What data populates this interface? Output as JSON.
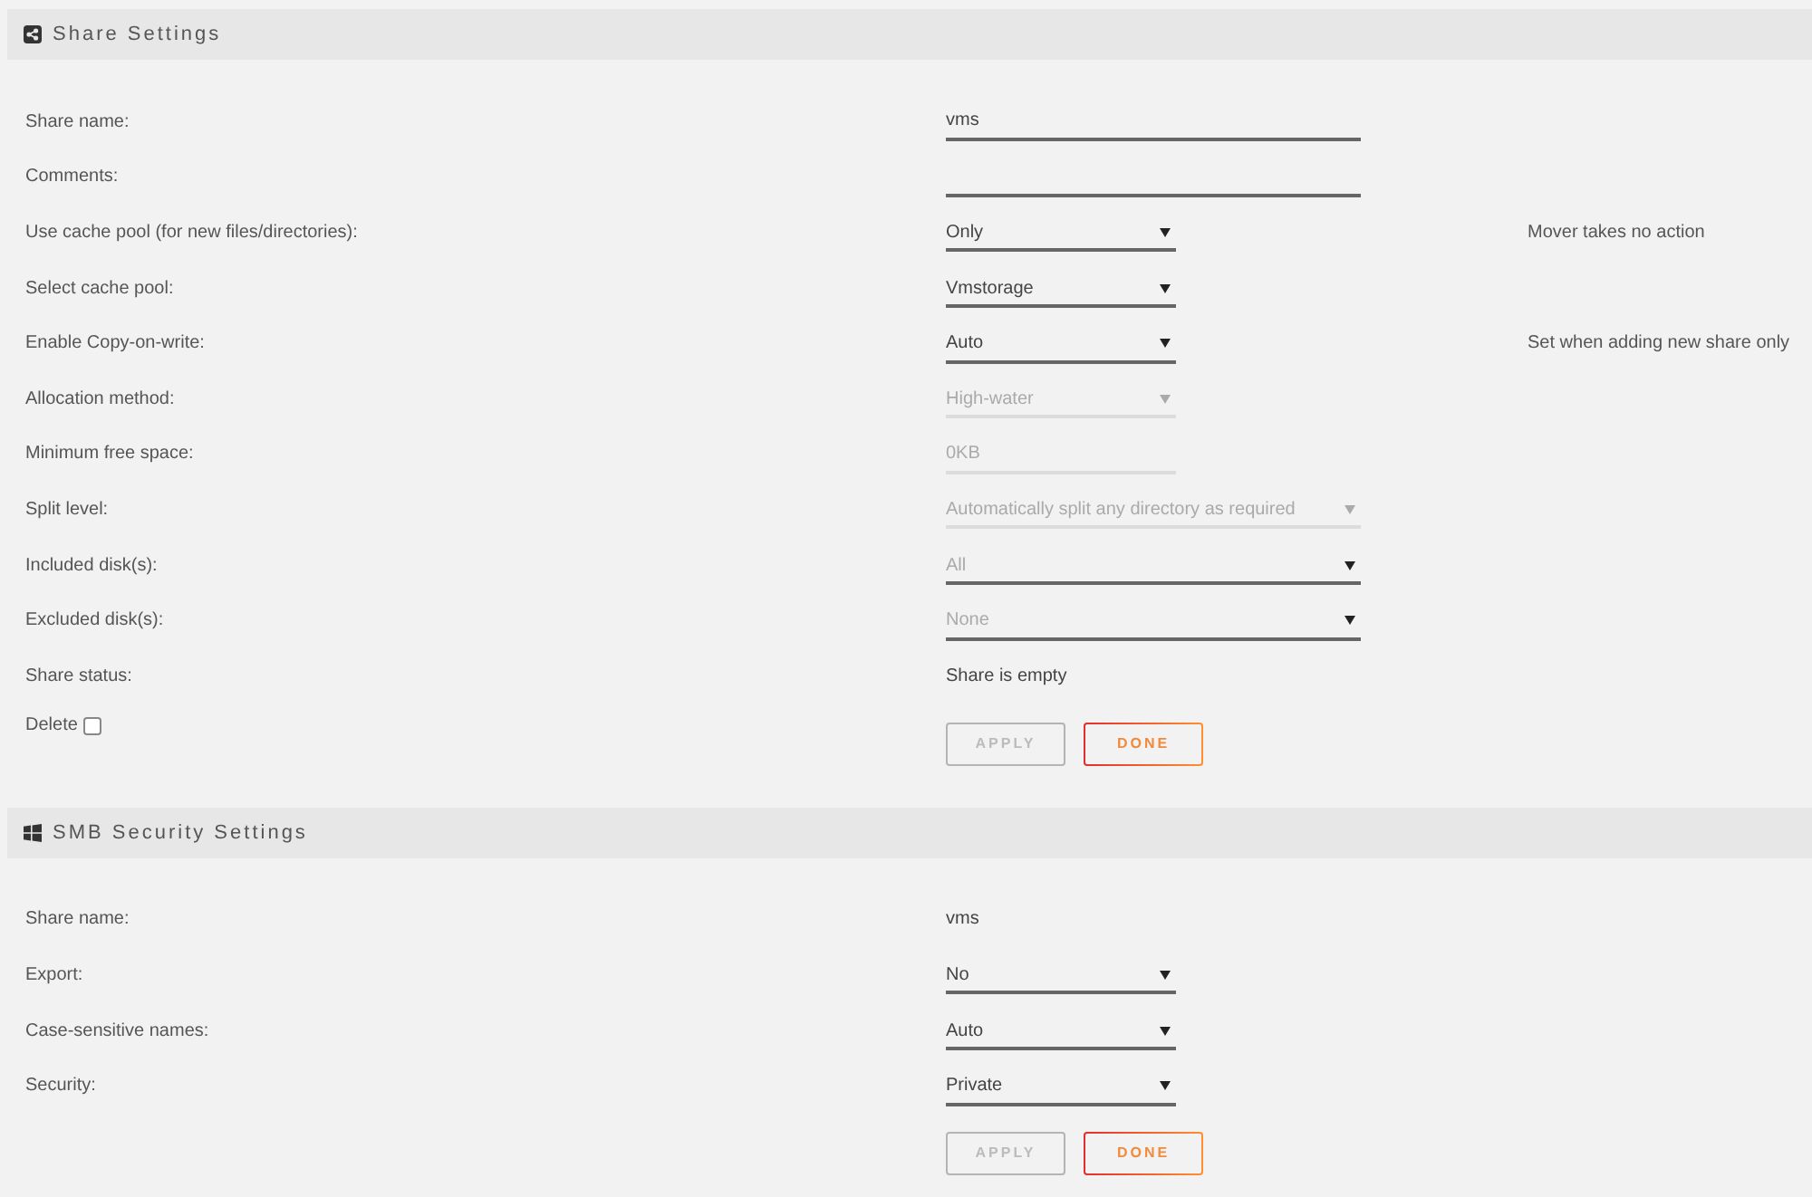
{
  "sections": [
    {
      "title": "Share Settings",
      "rows": [
        {
          "label": "Share name:",
          "kind": "text",
          "value": "vms",
          "disabled": false
        },
        {
          "label": "Comments:",
          "kind": "text",
          "disabled": false
        },
        {
          "label": "Use cache pool (for new files/directories):",
          "kind": "select",
          "value": "Only",
          "disabled": false,
          "note": "Mover takes no action"
        },
        {
          "label": "Select cache pool:",
          "kind": "select",
          "value": "Vmstorage",
          "disabled": false
        },
        {
          "label": "Enable Copy-on-write:",
          "kind": "select",
          "value": "Auto",
          "disabled": false,
          "note": "Set when adding new share only"
        },
        {
          "label": "Allocation method:",
          "kind": "select",
          "value": "High-water",
          "disabled": true
        },
        {
          "label": "Minimum free space:",
          "kind": "number",
          "value": "0KB",
          "disabled": true
        },
        {
          "label": "Split level:",
          "kind": "wideselect",
          "value": "Automatically split any directory as required",
          "disabled": true
        },
        {
          "label": "Included disk(s):",
          "kind": "wideselect",
          "placeholder": "All",
          "disabled": false
        },
        {
          "label": "Excluded disk(s):",
          "kind": "wideselect",
          "placeholder": "None",
          "disabled": false
        },
        {
          "label": "Share status:",
          "kind": "static",
          "value": "Share is empty",
          "disabled": false
        }
      ],
      "delete": {
        "label": "Delete",
        "checked": false
      },
      "buttons": [
        {
          "label": "APPLY",
          "disabled": true
        },
        {
          "label": "DONE",
          "disabled": false
        }
      ]
    },
    {
      "title": "SMB Security Settings",
      "rows": [
        {
          "label": "Share name:",
          "kind": "static",
          "value": "vms",
          "disabled": false
        },
        {
          "label": "Export:",
          "kind": "select",
          "value": "No",
          "disabled": false
        },
        {
          "label": "Case-sensitive names:",
          "kind": "select",
          "value": "Auto",
          "disabled": false
        },
        {
          "label": "Security:",
          "kind": "select",
          "value": "Private",
          "disabled": false
        }
      ],
      "buttons": [
        {
          "label": "APPLY",
          "disabled": true
        },
        {
          "label": "DONE",
          "disabled": false
        }
      ]
    }
  ]
}
